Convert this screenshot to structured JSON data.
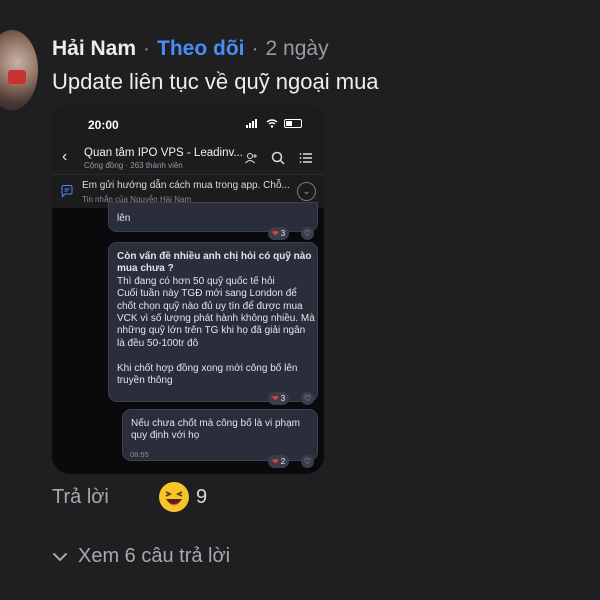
{
  "post": {
    "author": "Hải Nam",
    "separator": "·",
    "follow_label": "Theo dõi",
    "time": "2 ngày",
    "text": "Update liên tục về quỹ ngoại mua"
  },
  "screenshot": {
    "status_time": "20:00",
    "group_title": "Quan tâm IPO VPS - Leadinv...",
    "group_subtitle": "Cộng đồng · 263 thành viên",
    "pinned_text": "Em gửi hướng dẫn cách mua trong app. Chỗ...",
    "pinned_sub": "Tin nhắn của Nguyễn Hải Nam",
    "messages": [
      {
        "text": "lên",
        "reaction_count": "3"
      },
      {
        "bold": "Còn vấn đề nhiều anh chị hỏi có quỹ nào mua chưa ?",
        "text": "Thì đang có hơn 50 quỹ quốc tế hỏi\nCuối tuần này TGĐ mới sang London để chốt chọn quỹ nào đủ uy tín để được mua VCK vì số lượng phát hành không nhiều. Mà những quỹ lớn trên TG khi họ đã giải ngân là đều 50-100tr đô\n\nKhi chốt hợp đồng xong mới công bố lên truyền thông",
        "reaction_count": "3"
      },
      {
        "text": "Nếu chưa chốt mà công bố là vi phạm quy định với họ",
        "time": "08:55",
        "reaction_count": "2"
      }
    ]
  },
  "actions": {
    "reply_label": "Trả lời",
    "reaction_count": "9",
    "reaction_icon": "grinning-face-emoji",
    "see_replies_label": "Xem 6 câu trả lời"
  },
  "colors": {
    "background": "#1f1f21",
    "follow": "#4a8cf6",
    "bubble": "#2a2d3a"
  }
}
